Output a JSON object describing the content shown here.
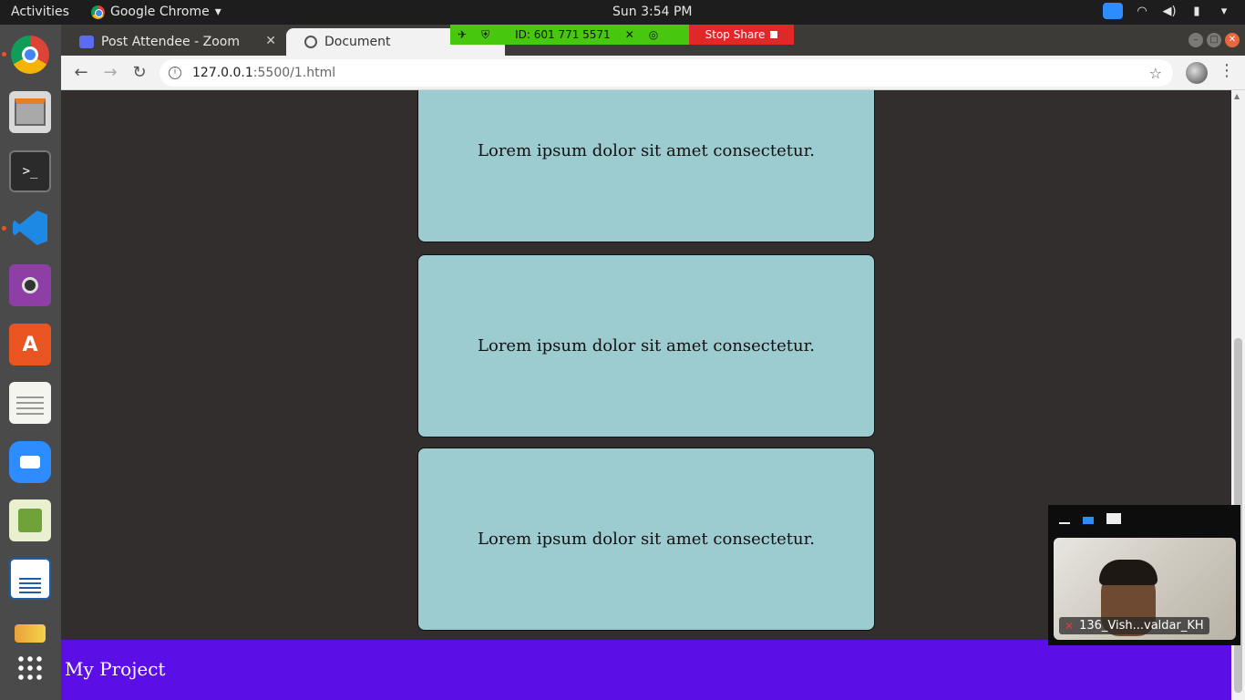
{
  "topbar": {
    "activities": "Activities",
    "app_name": "Google Chrome",
    "clock": "Sun  3:54 PM"
  },
  "tabs": [
    {
      "title": "Post Attendee - Zoom"
    },
    {
      "title": "Document"
    }
  ],
  "address_bar": {
    "host": "127.0.0.1",
    "path": ":5500/1.html"
  },
  "share_bar": {
    "meeting_id": "ID: 601 771 5571",
    "stop_label": "Stop Share"
  },
  "cards": [
    {
      "text": "Lorem ipsum dolor sit amet consectetur."
    },
    {
      "text": "Lorem ipsum dolor sit amet consectetur."
    },
    {
      "text": "Lorem ipsum dolor sit amet consectetur."
    }
  ],
  "footer": {
    "text": "My Project"
  },
  "video_panel": {
    "participant_name": "136_Vish...valdar_KH"
  },
  "colors": {
    "card_bg": "#9ccbd0",
    "page_bg": "#332e2e",
    "footer_bg": "#5b0ee6",
    "share_green": "#47c80f",
    "stop_red": "#e02828"
  }
}
